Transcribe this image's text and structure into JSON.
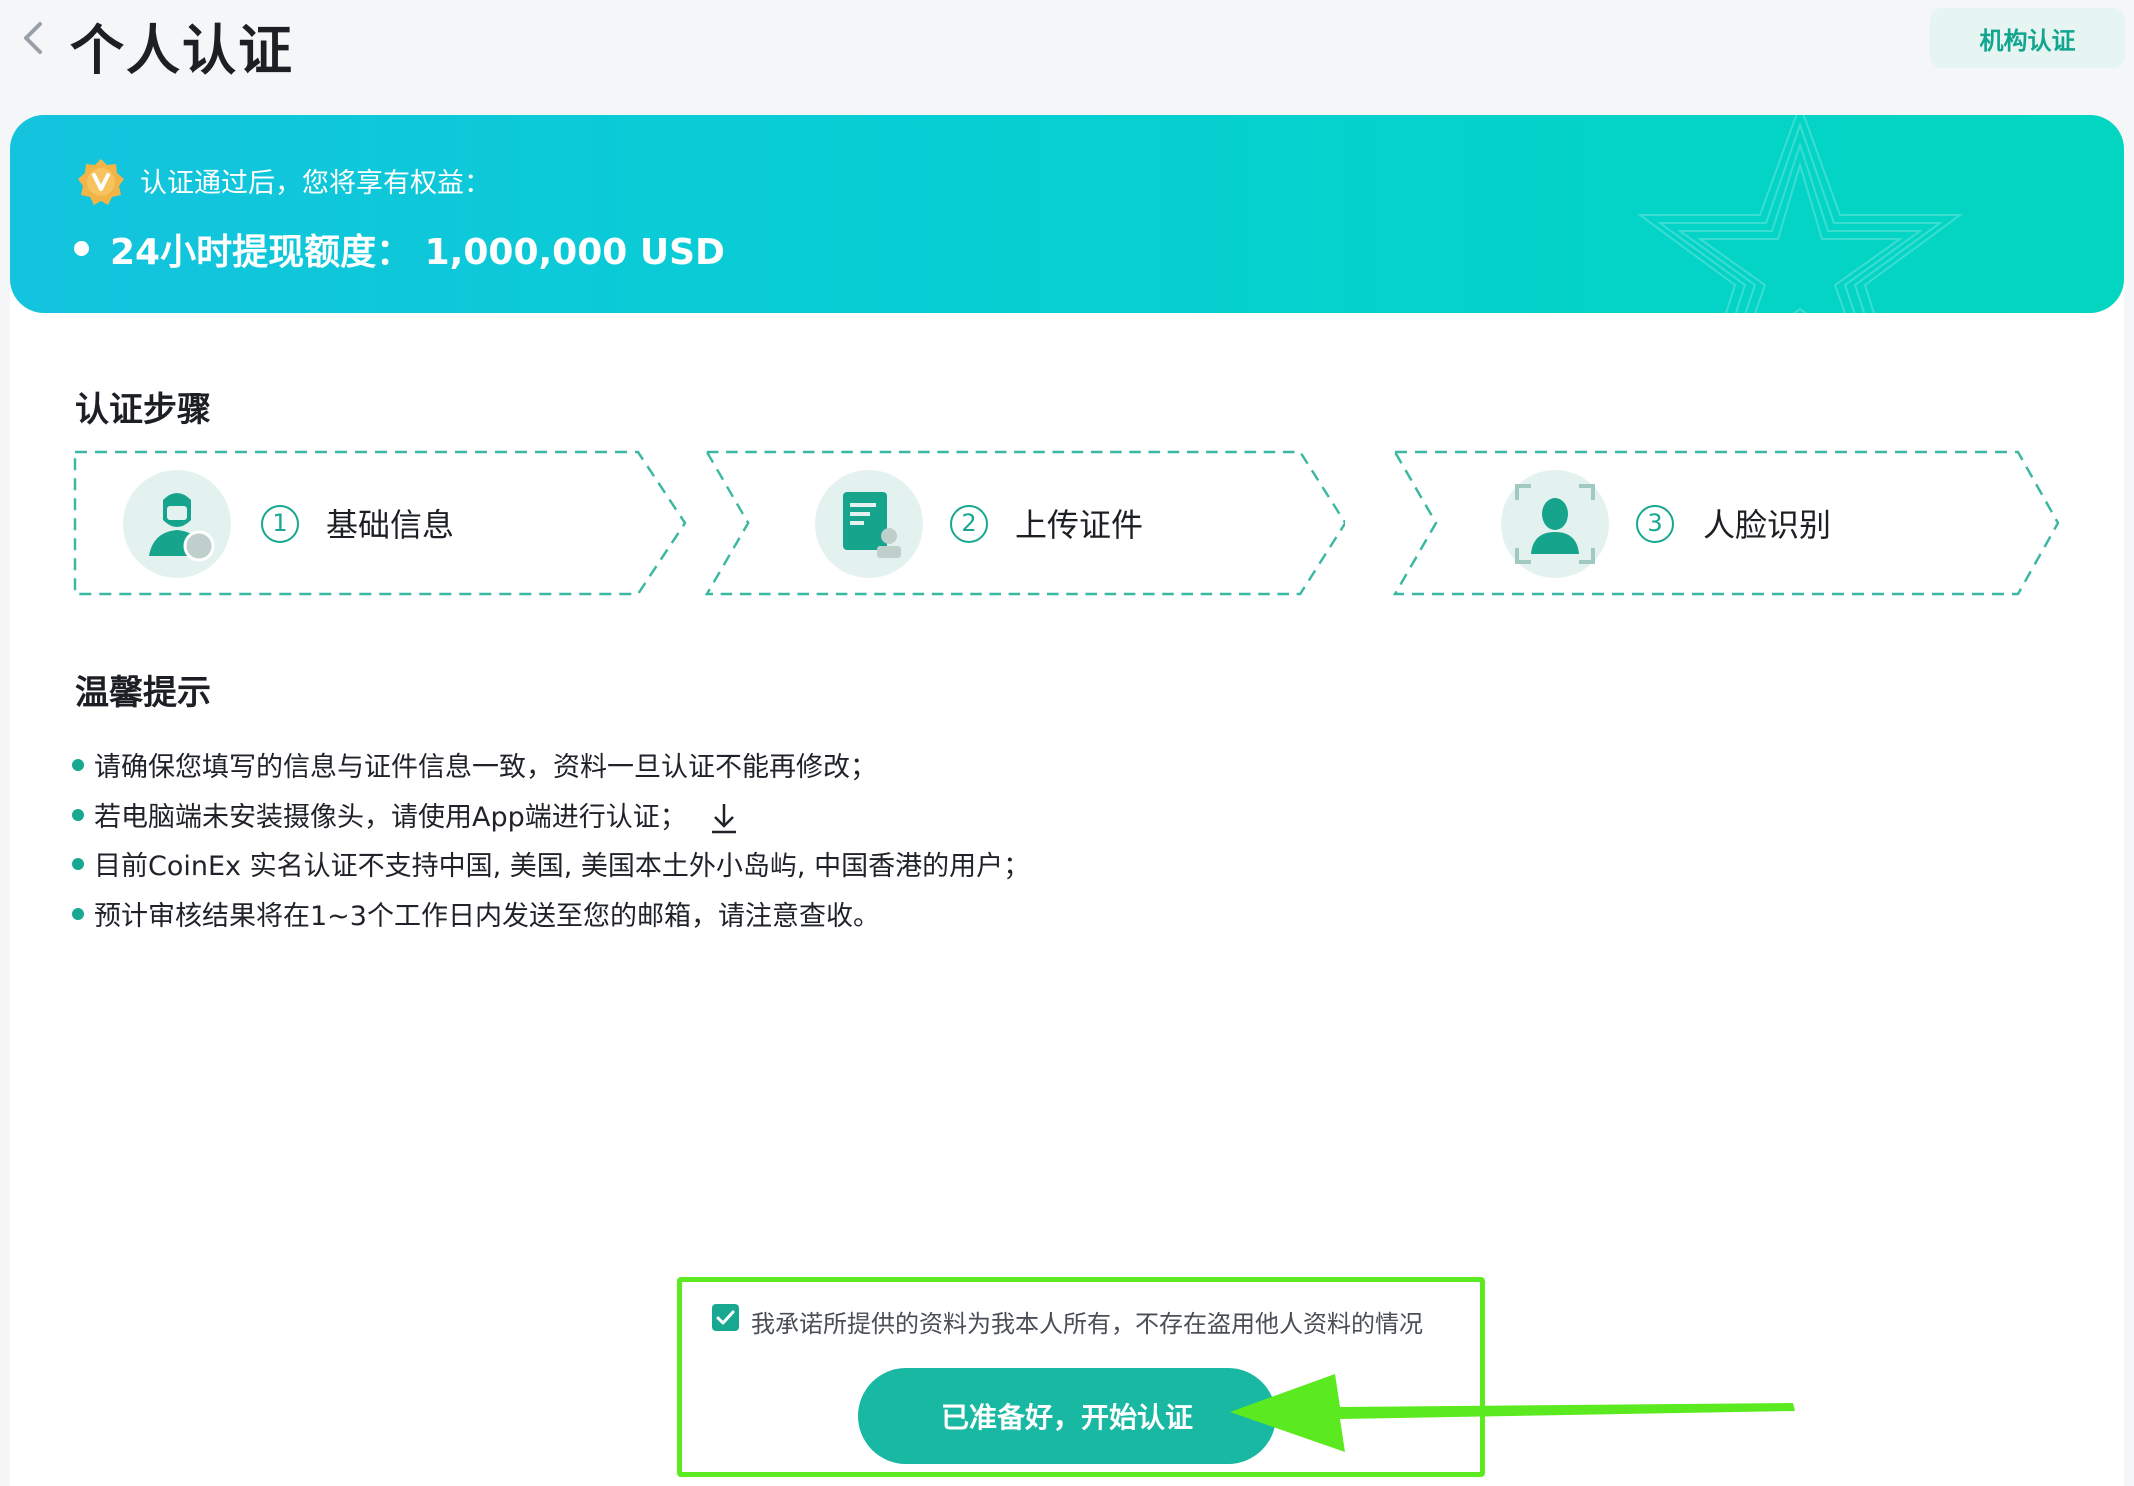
{
  "header": {
    "title": "个人认证",
    "org_button_label": "机构认证"
  },
  "banner": {
    "intro": "认证通过后，您将享有权益：",
    "benefit": "24小时提现额度：  1,000,000 USD"
  },
  "steps_section": {
    "title": "认证步骤",
    "steps": [
      {
        "number": "1",
        "label": "基础信息",
        "icon": "user-info-icon"
      },
      {
        "number": "2",
        "label": "上传证件",
        "icon": "id-document-icon"
      },
      {
        "number": "3",
        "label": "人脸识别",
        "icon": "face-scan-icon"
      }
    ]
  },
  "tips_section": {
    "title": "温馨提示",
    "items": [
      "请确保您填写的信息与证件信息一致，资料一旦认证不能再修改；",
      "若电脑端未安装摄像头，请使用App端进行认证；",
      "目前CoinEx 实名认证不支持中国, 美国, 美国本土外小岛屿, 中国香港的用户；",
      "预计审核结果将在1~3个工作日内发送至您的邮箱，请注意查收。"
    ]
  },
  "agreement": {
    "checked": true,
    "text": "我承诺所提供的资料为我本人所有，不存在盗用他人资料的情况",
    "button_label": "已准备好，开始认证"
  },
  "colors": {
    "accent": "#18a891",
    "button": "#18b8a2",
    "banner_start": "#14c3de",
    "banner_end": "#03d6c0",
    "highlight": "#5bea1f"
  }
}
